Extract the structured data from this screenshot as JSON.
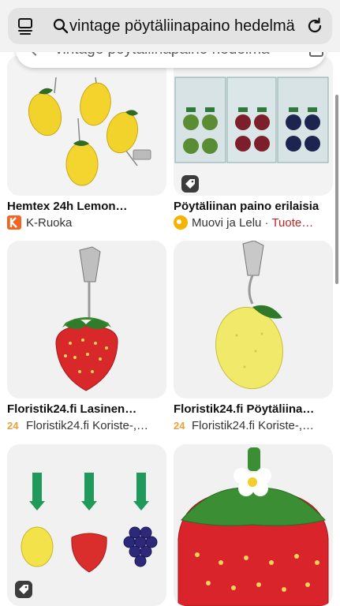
{
  "browser": {
    "url_text": "vintage pöytäliinapaino hedelmä",
    "tab_icon": "tabs-icon",
    "search_icon": "search-icon",
    "reload_icon": "reload-icon"
  },
  "search_bar": {
    "query": "vintage pöytäliinapaino hedelmä"
  },
  "results": [
    {
      "title": "Hemtex 24h Lemon…",
      "source": "K-Ruoka",
      "source_extra": ""
    },
    {
      "title": "Pöytäliinan paino erilaisia",
      "source": "Muovi ja Lelu",
      "separator": " · ",
      "source_extra": "Tuote…"
    },
    {
      "title": "Floristik24.fi Lasinen…",
      "source": "Floristik24.fi Koriste-,…",
      "source_extra": ""
    },
    {
      "title": "Floristik24.fi Pöytäliina…",
      "source": "Floristik24.fi Koriste-,…",
      "source_extra": ""
    },
    {
      "title": "",
      "source": "",
      "source_extra": ""
    },
    {
      "title": "",
      "source": "",
      "source_extra": ""
    }
  ],
  "colors": {
    "kruoka": "#f26522",
    "muovi": "#f5b400",
    "floristik": "#e8a23a",
    "sale_red": "#c5221f"
  }
}
